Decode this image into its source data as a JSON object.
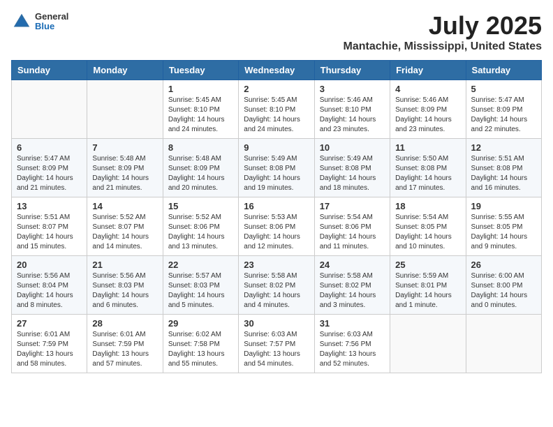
{
  "header": {
    "logo": {
      "general": "General",
      "blue": "Blue"
    },
    "title": "July 2025",
    "location": "Mantachie, Mississippi, United States"
  },
  "weekdays": [
    "Sunday",
    "Monday",
    "Tuesday",
    "Wednesday",
    "Thursday",
    "Friday",
    "Saturday"
  ],
  "weeks": [
    [
      {
        "day": "",
        "sunrise": "",
        "sunset": "",
        "daylight": ""
      },
      {
        "day": "",
        "sunrise": "",
        "sunset": "",
        "daylight": ""
      },
      {
        "day": "1",
        "sunrise": "Sunrise: 5:45 AM",
        "sunset": "Sunset: 8:10 PM",
        "daylight": "Daylight: 14 hours and 24 minutes."
      },
      {
        "day": "2",
        "sunrise": "Sunrise: 5:45 AM",
        "sunset": "Sunset: 8:10 PM",
        "daylight": "Daylight: 14 hours and 24 minutes."
      },
      {
        "day": "3",
        "sunrise": "Sunrise: 5:46 AM",
        "sunset": "Sunset: 8:10 PM",
        "daylight": "Daylight: 14 hours and 23 minutes."
      },
      {
        "day": "4",
        "sunrise": "Sunrise: 5:46 AM",
        "sunset": "Sunset: 8:09 PM",
        "daylight": "Daylight: 14 hours and 23 minutes."
      },
      {
        "day": "5",
        "sunrise": "Sunrise: 5:47 AM",
        "sunset": "Sunset: 8:09 PM",
        "daylight": "Daylight: 14 hours and 22 minutes."
      }
    ],
    [
      {
        "day": "6",
        "sunrise": "Sunrise: 5:47 AM",
        "sunset": "Sunset: 8:09 PM",
        "daylight": "Daylight: 14 hours and 21 minutes."
      },
      {
        "day": "7",
        "sunrise": "Sunrise: 5:48 AM",
        "sunset": "Sunset: 8:09 PM",
        "daylight": "Daylight: 14 hours and 21 minutes."
      },
      {
        "day": "8",
        "sunrise": "Sunrise: 5:48 AM",
        "sunset": "Sunset: 8:09 PM",
        "daylight": "Daylight: 14 hours and 20 minutes."
      },
      {
        "day": "9",
        "sunrise": "Sunrise: 5:49 AM",
        "sunset": "Sunset: 8:08 PM",
        "daylight": "Daylight: 14 hours and 19 minutes."
      },
      {
        "day": "10",
        "sunrise": "Sunrise: 5:49 AM",
        "sunset": "Sunset: 8:08 PM",
        "daylight": "Daylight: 14 hours and 18 minutes."
      },
      {
        "day": "11",
        "sunrise": "Sunrise: 5:50 AM",
        "sunset": "Sunset: 8:08 PM",
        "daylight": "Daylight: 14 hours and 17 minutes."
      },
      {
        "day": "12",
        "sunrise": "Sunrise: 5:51 AM",
        "sunset": "Sunset: 8:08 PM",
        "daylight": "Daylight: 14 hours and 16 minutes."
      }
    ],
    [
      {
        "day": "13",
        "sunrise": "Sunrise: 5:51 AM",
        "sunset": "Sunset: 8:07 PM",
        "daylight": "Daylight: 14 hours and 15 minutes."
      },
      {
        "day": "14",
        "sunrise": "Sunrise: 5:52 AM",
        "sunset": "Sunset: 8:07 PM",
        "daylight": "Daylight: 14 hours and 14 minutes."
      },
      {
        "day": "15",
        "sunrise": "Sunrise: 5:52 AM",
        "sunset": "Sunset: 8:06 PM",
        "daylight": "Daylight: 14 hours and 13 minutes."
      },
      {
        "day": "16",
        "sunrise": "Sunrise: 5:53 AM",
        "sunset": "Sunset: 8:06 PM",
        "daylight": "Daylight: 14 hours and 12 minutes."
      },
      {
        "day": "17",
        "sunrise": "Sunrise: 5:54 AM",
        "sunset": "Sunset: 8:06 PM",
        "daylight": "Daylight: 14 hours and 11 minutes."
      },
      {
        "day": "18",
        "sunrise": "Sunrise: 5:54 AM",
        "sunset": "Sunset: 8:05 PM",
        "daylight": "Daylight: 14 hours and 10 minutes."
      },
      {
        "day": "19",
        "sunrise": "Sunrise: 5:55 AM",
        "sunset": "Sunset: 8:05 PM",
        "daylight": "Daylight: 14 hours and 9 minutes."
      }
    ],
    [
      {
        "day": "20",
        "sunrise": "Sunrise: 5:56 AM",
        "sunset": "Sunset: 8:04 PM",
        "daylight": "Daylight: 14 hours and 8 minutes."
      },
      {
        "day": "21",
        "sunrise": "Sunrise: 5:56 AM",
        "sunset": "Sunset: 8:03 PM",
        "daylight": "Daylight: 14 hours and 6 minutes."
      },
      {
        "day": "22",
        "sunrise": "Sunrise: 5:57 AM",
        "sunset": "Sunset: 8:03 PM",
        "daylight": "Daylight: 14 hours and 5 minutes."
      },
      {
        "day": "23",
        "sunrise": "Sunrise: 5:58 AM",
        "sunset": "Sunset: 8:02 PM",
        "daylight": "Daylight: 14 hours and 4 minutes."
      },
      {
        "day": "24",
        "sunrise": "Sunrise: 5:58 AM",
        "sunset": "Sunset: 8:02 PM",
        "daylight": "Daylight: 14 hours and 3 minutes."
      },
      {
        "day": "25",
        "sunrise": "Sunrise: 5:59 AM",
        "sunset": "Sunset: 8:01 PM",
        "daylight": "Daylight: 14 hours and 1 minute."
      },
      {
        "day": "26",
        "sunrise": "Sunrise: 6:00 AM",
        "sunset": "Sunset: 8:00 PM",
        "daylight": "Daylight: 14 hours and 0 minutes."
      }
    ],
    [
      {
        "day": "27",
        "sunrise": "Sunrise: 6:01 AM",
        "sunset": "Sunset: 7:59 PM",
        "daylight": "Daylight: 13 hours and 58 minutes."
      },
      {
        "day": "28",
        "sunrise": "Sunrise: 6:01 AM",
        "sunset": "Sunset: 7:59 PM",
        "daylight": "Daylight: 13 hours and 57 minutes."
      },
      {
        "day": "29",
        "sunrise": "Sunrise: 6:02 AM",
        "sunset": "Sunset: 7:58 PM",
        "daylight": "Daylight: 13 hours and 55 minutes."
      },
      {
        "day": "30",
        "sunrise": "Sunrise: 6:03 AM",
        "sunset": "Sunset: 7:57 PM",
        "daylight": "Daylight: 13 hours and 54 minutes."
      },
      {
        "day": "31",
        "sunrise": "Sunrise: 6:03 AM",
        "sunset": "Sunset: 7:56 PM",
        "daylight": "Daylight: 13 hours and 52 minutes."
      },
      {
        "day": "",
        "sunrise": "",
        "sunset": "",
        "daylight": ""
      },
      {
        "day": "",
        "sunrise": "",
        "sunset": "",
        "daylight": ""
      }
    ]
  ]
}
